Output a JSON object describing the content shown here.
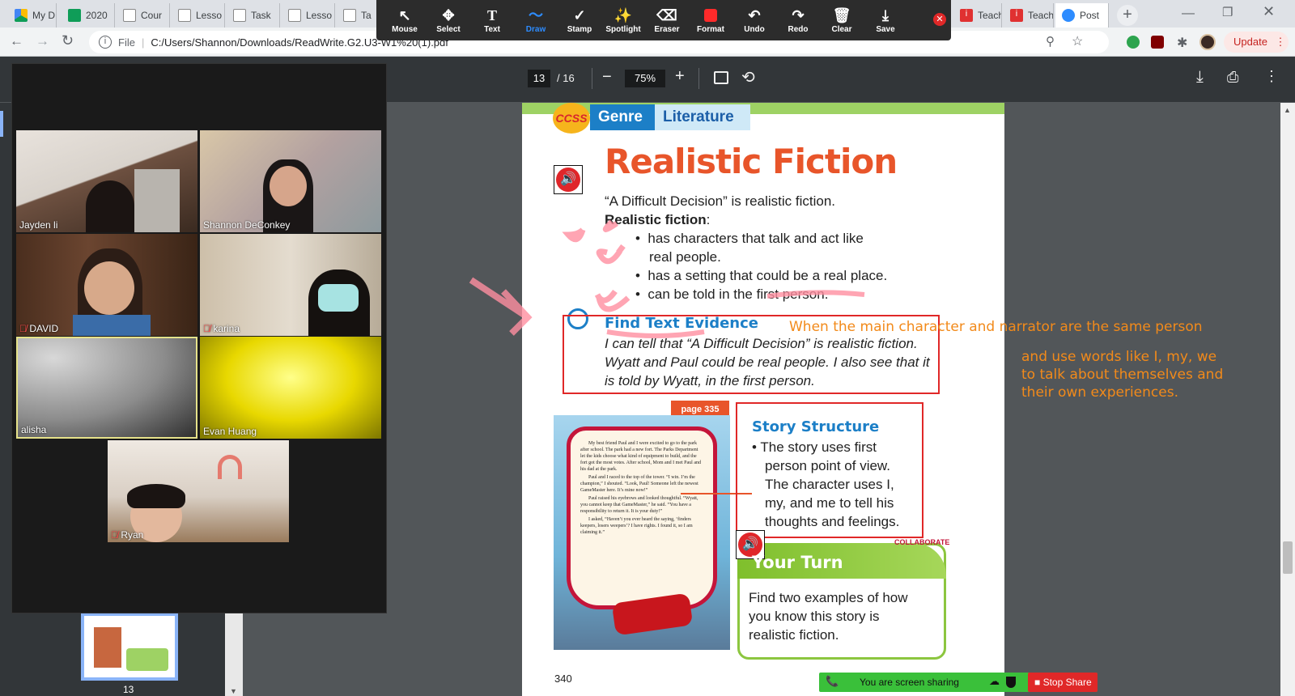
{
  "browser": {
    "tabs": [
      "My D",
      "2020",
      "Cour",
      "Lesso",
      "Task",
      "Lesso",
      "Ta",
      "Teach",
      "Teach",
      "Post"
    ],
    "address": "C:/Users/Shannon/Downloads/ReadWrite.G2.U3-W1%20(1).pdf",
    "file_label": "File",
    "update_label": "Update"
  },
  "annotation_toolbar": {
    "tools": [
      "Mouse",
      "Select",
      "Text",
      "Draw",
      "Stamp",
      "Spotlight",
      "Eraser",
      "Format",
      "Undo",
      "Redo",
      "Clear",
      "Save"
    ],
    "active": "Draw",
    "format_color": "#ff2a2a"
  },
  "pdf_toolbar": {
    "page_current": "13",
    "page_total": "/ 16",
    "zoom": "75%"
  },
  "participants": [
    {
      "name": "Jayden li",
      "muted": false
    },
    {
      "name": "Shannon DeConkey",
      "muted": false
    },
    {
      "name": "DAVID",
      "muted": true
    },
    {
      "name": "karina",
      "muted": true
    },
    {
      "name": "alisha",
      "muted": false
    },
    {
      "name": "Evan Huang",
      "muted": false
    },
    {
      "name": "Ryan",
      "muted": true
    }
  ],
  "thumbnail": {
    "label": "13"
  },
  "pdf_page": {
    "ccss": "CCSS",
    "genre": "Genre",
    "genre_value": "Literature",
    "title": "Realistic Fiction",
    "intro": "“A Difficult Decision” is realistic fiction.",
    "def_label": "Realistic fiction",
    "bullets": [
      "has characters that talk and act like",
      "real people.",
      "has a setting that could be a real place.",
      "can be told in the first person."
    ],
    "evidence_title": "Find Text Evidence",
    "evidence_lines": [
      "I can tell that “A Difficult Decision” is realistic fiction.",
      "Wyatt and Paul could be real people. I also see that it",
      "is told by Wyatt, in the first person."
    ],
    "page_tag": "page 335",
    "story_paragraphs": [
      "My best friend Paul and I were excited to go to the park after school. The park had a new fort. The Parks Department let the kids choose what kind of equipment to build, and the fort got the most votes. After school, Mom and I met Paul and his dad at the park.",
      "Paul and I raced to the top of the tower. “I win. I’m the champion,” I shouted. “Look, Paul! Someone left the newest GameMaster here. It’s mine now!”",
      "Paul raised his eyebrows and looked thoughtful. “Wyatt, you cannot keep that GameMaster,” he said. “You have a responsibility to return it. It is your duty!”",
      "I asked, “Haven’t you ever heard the saying, ‘finders keepers, losers weepers’? I have rights. I found it, so I am claiming it.”"
    ],
    "structure_title": "Story Structure",
    "structure_lines": [
      "The story uses first",
      "person point of view.",
      "The character uses I,",
      "my, and me to tell his",
      "thoughts and feelings."
    ],
    "collaborate": "COLLABORATE",
    "your_turn": "Your Turn",
    "your_turn_lines": [
      "Find two examples of how",
      "you know this story is",
      "realistic fiction."
    ],
    "page_number": "340"
  },
  "annotations": {
    "note1": "When the main character and narrator are the same person",
    "note2": [
      "and use words like I, my, we",
      "to talk about themselves and",
      "their own experiences."
    ]
  },
  "share_bar": {
    "status": "You are screen sharing",
    "stop": "Stop Share"
  }
}
